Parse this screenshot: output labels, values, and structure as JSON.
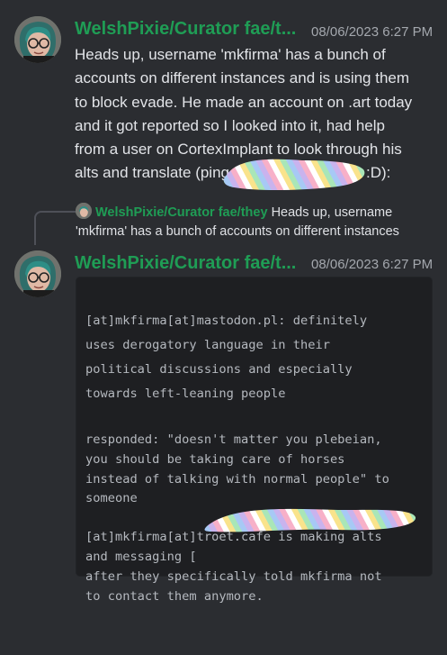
{
  "messages": [
    {
      "author": "WelshPixie/Curator fae/t...",
      "timestamp": "08/06/2023 6:27 PM",
      "lines": [
        "Heads up, username 'mkfirma' has a bunch of",
        "accounts on different instances and is using them",
        "to block evade. He made an account on .art today",
        "and it got reported so I looked into it, had help",
        "from a user on CortexImplant to look through his",
        "alts and translate (ping",
        ":D):"
      ]
    },
    {
      "author": "WelshPixie/Curator fae/t...",
      "timestamp": "08/06/2023 6:27 PM",
      "reply": {
        "author": "WelshPixie/Curator fae/they",
        "text_line1": "Heads up, username",
        "text_line2": "'mkfirma' has a bunch of accounts on different instances"
      },
      "code_lines": [
        "[at]mkfirma[at]mastodon.pl: definitely",
        "uses derogatory language in their",
        "political discussions and especially",
        "towards left-leaning people",
        "",
        "responded: \"doesn't matter you plebeian,",
        "you should be taking care of horses",
        "instead of talking with normal people\" to",
        "someone",
        "",
        "[at]mkfirma[at]troet.cafe is making alts",
        "and messaging [",
        "after they specifically told mkfirma not",
        "to contact them anymore."
      ]
    }
  ],
  "icons": [
    "avatar",
    "rainbow-scribble-redaction"
  ]
}
